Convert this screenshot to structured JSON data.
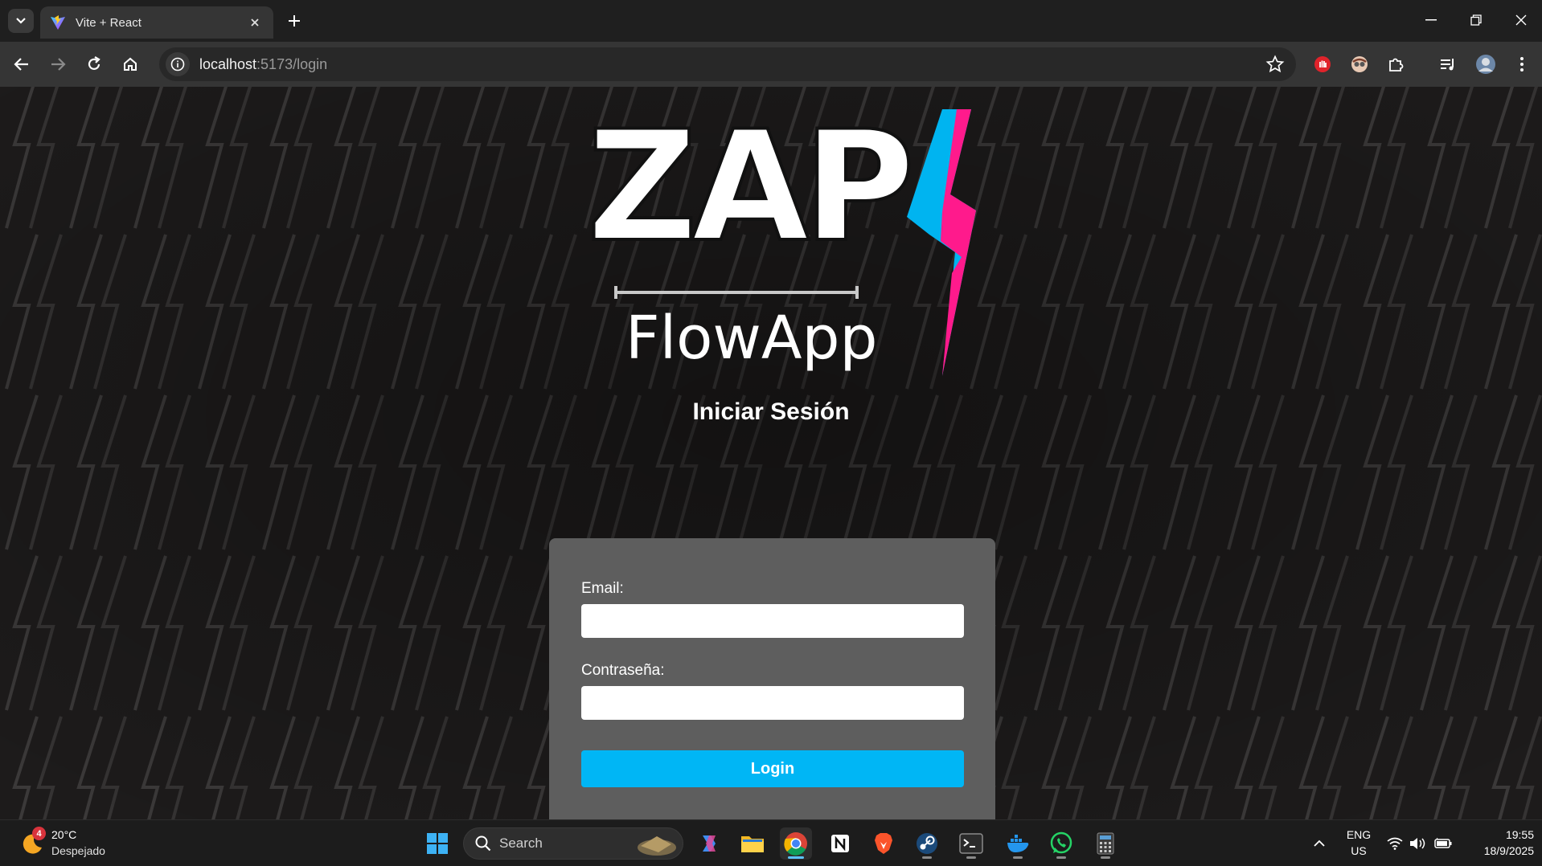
{
  "browser": {
    "tab_title": "Vite + React",
    "url_host": "localhost",
    "url_path": ":5173/login"
  },
  "logo": {
    "wordmark": "ZAP",
    "subtitle": "FlowApp",
    "bolt_colors": [
      "#00b4f0",
      "#ff1a8c"
    ]
  },
  "page": {
    "title": "Iniciar Sesión"
  },
  "form": {
    "email_label": "Email:",
    "email_value": "",
    "password_label": "Contraseña:",
    "password_value": "",
    "submit_label": "Login",
    "accent_color": "#00b6f5"
  },
  "taskbar": {
    "weather_temp": "20°C",
    "weather_condition": "Despejado",
    "weather_badge": "4",
    "search_placeholder": "Search",
    "language_line1": "ENG",
    "language_line2": "US",
    "time": "19:55",
    "date": "18/9/2025",
    "apps": [
      "windows-start-icon",
      "copilot-icon",
      "file-explorer-icon",
      "chrome-icon",
      "notion-icon",
      "brave-icon",
      "steam-icon",
      "terminal-icon",
      "docker-icon",
      "whatsapp-icon",
      "calculator-icon"
    ]
  }
}
